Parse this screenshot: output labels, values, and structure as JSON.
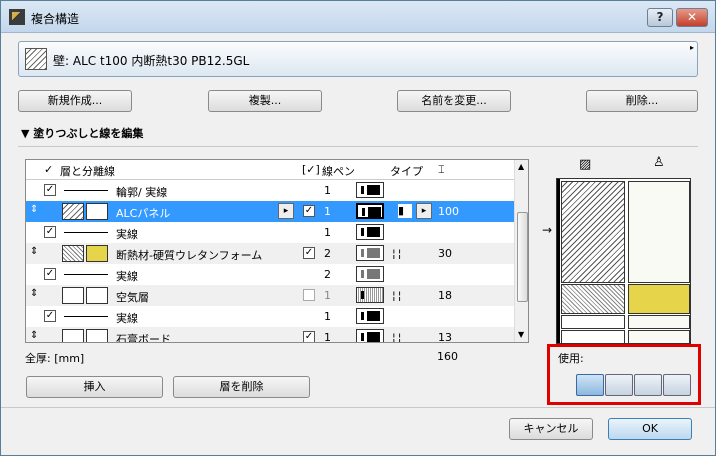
{
  "window": {
    "title": "複合構造",
    "help": "?",
    "close": "✕"
  },
  "header": {
    "name": "壁: ALC t100 内断熱t30 PB12.5GL",
    "arrow": "▸"
  },
  "buttons": {
    "new": "新規作成...",
    "duplicate": "複製...",
    "rename": "名前を変更...",
    "delete": "削除...",
    "insert": "挿入",
    "delete_layer": "層を削除",
    "cancel": "キャンセル",
    "ok": "OK"
  },
  "section": {
    "title": "▼ 塗りつぶしと線を編集"
  },
  "table": {
    "headers": {
      "check": "✓",
      "layers": "層と分離線",
      "core": "[✓]",
      "pen": "線ペン",
      "type": "タイプ",
      "thick": "⌶"
    },
    "rows": [
      {
        "kind": "line",
        "name": "輪郭/ 実線",
        "check": "✓",
        "pen": "1",
        "thick": ""
      },
      {
        "kind": "layer",
        "name": "ALCパネル",
        "check": "✓",
        "pen": "1",
        "thick": "100",
        "sel": true
      },
      {
        "kind": "line",
        "name": "実線",
        "check": "✓",
        "pen": "1",
        "thick": ""
      },
      {
        "kind": "layer",
        "name": "断熱材-硬質ウレタンフォーム",
        "check": "✓",
        "pen": "2",
        "thick": "30"
      },
      {
        "kind": "line",
        "name": "実線",
        "check": "✓",
        "pen": "2",
        "thick": ""
      },
      {
        "kind": "layer",
        "name": "空気層",
        "check": "✓",
        "pen": "1",
        "thick": "18"
      },
      {
        "kind": "line",
        "name": "実線",
        "check": "✓",
        "pen": "1",
        "thick": ""
      },
      {
        "kind": "layer",
        "name": "石膏ボード",
        "check": "✓",
        "pen": "1",
        "thick": "13"
      }
    ]
  },
  "footer": {
    "total_label": "全厚: [mm]",
    "total_value": "160"
  },
  "usage": {
    "label": "使用:"
  },
  "colors": {
    "accent": "#3399ff",
    "insulation": "#e6d44a",
    "highlight": "#e00000"
  }
}
